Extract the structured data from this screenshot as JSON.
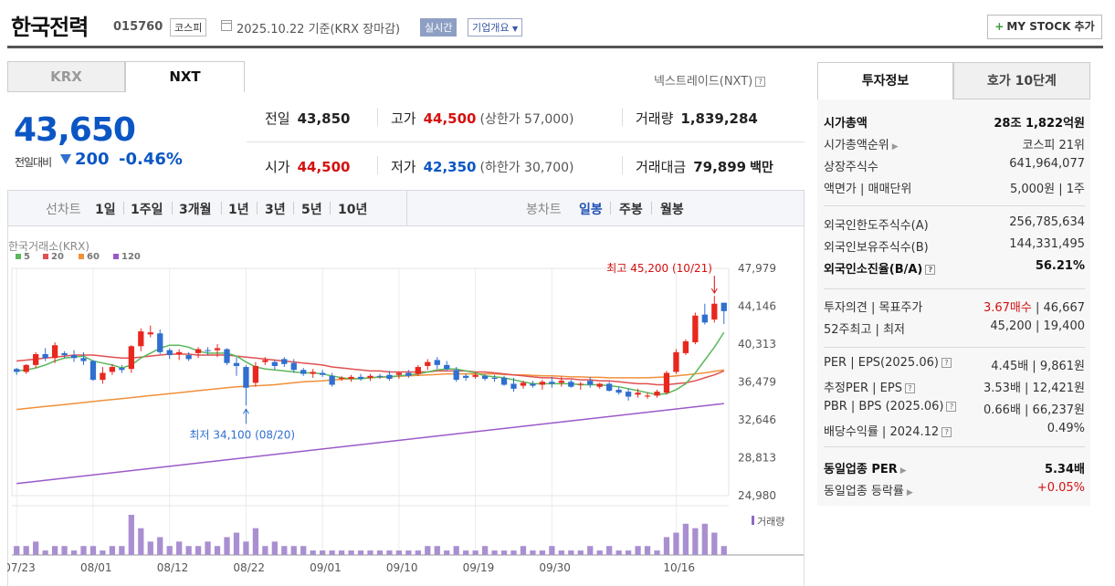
{
  "header": {
    "title": "한국전력",
    "code": "015760",
    "market": "코스피",
    "date": "2025.10.22 기준(KRX 장마감)",
    "realtime": "실시간",
    "company_info": "기업개요",
    "mystock": "MY STOCK 추가"
  },
  "exchange_tabs": [
    "KRX",
    "NXT"
  ],
  "nxt_link": "넥스트레이드(NXT)",
  "price": {
    "current": "43,650",
    "change_label": "전일대비",
    "change": "200",
    "change_pct": "-0.46%"
  },
  "summary": {
    "prev_close_label": "전일",
    "prev_close": "43,850",
    "high_label": "고가",
    "high": "44,500",
    "upper_limit": "(상한가 57,000)",
    "volume_label": "거래량",
    "volume": "1,839,284",
    "open_label": "시가",
    "open": "44,500",
    "low_label": "저가",
    "low": "42,350",
    "lower_limit": "(하한가 30,700)",
    "value_label": "거래대금",
    "value": "79,899",
    "value_unit": "백만"
  },
  "period_bar": {
    "line_label": "선차트",
    "periods": [
      "1일",
      "1주일",
      "3개월",
      "1년",
      "3년",
      "5년",
      "10년"
    ],
    "candle_label": "봉차트",
    "candles": [
      "일봉",
      "주봉",
      "월봉"
    ],
    "selected_candle": "일봉"
  },
  "chart": {
    "source": "한국거래소(KRX)",
    "ma_legend": [
      {
        "label": "5",
        "color": "#5cb85c"
      },
      {
        "label": "20",
        "color": "#e05050"
      },
      {
        "label": "60",
        "color": "#f0903a"
      },
      {
        "label": "120",
        "color": "#9b59c9"
      }
    ],
    "y_ticks": [
      "47,979",
      "44,146",
      "40,313",
      "36,479",
      "32,646",
      "28,813",
      "24,980"
    ],
    "x_ticks": [
      "07/23",
      "08/01",
      "08/12",
      "08/22",
      "09/01",
      "09/10",
      "09/19",
      "09/30",
      "10/16"
    ],
    "high_note": "최고 45,200 (10/21)",
    "low_note": "최저 34,100 (08/20)",
    "volume_label": "거래량"
  },
  "chart_data": {
    "type": "candlestick",
    "ylim": [
      24980,
      47979
    ],
    "candles": [
      [
        37800,
        37900,
        37200,
        37500
      ],
      [
        37500,
        38300,
        37300,
        38200
      ],
      [
        38200,
        39500,
        37900,
        39300
      ],
      [
        39300,
        39900,
        38600,
        38900
      ],
      [
        38900,
        40500,
        38400,
        40200
      ],
      [
        39400,
        39600,
        38900,
        39200
      ],
      [
        39200,
        39700,
        38500,
        38900
      ],
      [
        38900,
        39500,
        38200,
        38600
      ],
      [
        38600,
        38700,
        36600,
        36700
      ],
      [
        36700,
        38000,
        36300,
        37400
      ],
      [
        37500,
        38300,
        37200,
        38000
      ],
      [
        37900,
        38200,
        37400,
        37700
      ],
      [
        37800,
        40200,
        37400,
        40100
      ],
      [
        40100,
        41900,
        39600,
        41600
      ],
      [
        41300,
        42200,
        41000,
        41500
      ],
      [
        41400,
        41800,
        39300,
        39500
      ],
      [
        39700,
        39900,
        38800,
        39200
      ],
      [
        39300,
        39800,
        38700,
        39500
      ],
      [
        39200,
        39500,
        38600,
        38800
      ],
      [
        39400,
        40000,
        38900,
        39800
      ],
      [
        39700,
        40000,
        39200,
        39600
      ],
      [
        39700,
        40300,
        39000,
        39900
      ],
      [
        39800,
        39900,
        38200,
        38400
      ],
      [
        38400,
        39000,
        37100,
        38100
      ],
      [
        38000,
        38200,
        34100,
        35900
      ],
      [
        36400,
        38500,
        36000,
        38100
      ],
      [
        38500,
        39000,
        38200,
        38700
      ],
      [
        38500,
        38700,
        37700,
        38100
      ],
      [
        38800,
        39000,
        38000,
        38300
      ],
      [
        38400,
        38800,
        37400,
        37700
      ],
      [
        37700,
        37900,
        37100,
        37300
      ],
      [
        37300,
        37800,
        36900,
        37500
      ],
      [
        37400,
        37700,
        37000,
        37200
      ],
      [
        37100,
        37400,
        36000,
        36200
      ],
      [
        36800,
        37100,
        36600,
        36900
      ],
      [
        36800,
        37200,
        36500,
        37000
      ],
      [
        37000,
        37300,
        36600,
        36800
      ],
      [
        36900,
        37300,
        36600,
        37100
      ],
      [
        37100,
        37300,
        36800,
        37000
      ],
      [
        37200,
        37600,
        36600,
        36800
      ],
      [
        37200,
        37500,
        36800,
        37400
      ],
      [
        37400,
        37700,
        36900,
        37100
      ],
      [
        37300,
        38200,
        37100,
        38000
      ],
      [
        38100,
        38800,
        37700,
        38500
      ],
      [
        38700,
        39000,
        37800,
        38200
      ],
      [
        38200,
        38600,
        37600,
        37800
      ],
      [
        37700,
        38000,
        36500,
        36700
      ],
      [
        37100,
        37300,
        36600,
        36900
      ],
      [
        37000,
        37400,
        36800,
        37200
      ],
      [
        37100,
        37300,
        36600,
        36800
      ],
      [
        36900,
        37200,
        36500,
        36800
      ],
      [
        36900,
        37100,
        36100,
        36200
      ],
      [
        36300,
        36900,
        35500,
        35800
      ],
      [
        36100,
        36600,
        35800,
        36400
      ],
      [
        36300,
        36600,
        35900,
        36100
      ],
      [
        36200,
        36700,
        35700,
        36500
      ],
      [
        36500,
        37000,
        35900,
        36300
      ],
      [
        36400,
        37000,
        36000,
        36600
      ],
      [
        36500,
        36700,
        35900,
        36000
      ],
      [
        36200,
        36500,
        35700,
        36300
      ],
      [
        36600,
        37000,
        35900,
        36200
      ],
      [
        36000,
        36400,
        35800,
        36300
      ],
      [
        36300,
        36500,
        35500,
        35600
      ],
      [
        35700,
        36000,
        35200,
        35400
      ],
      [
        35500,
        35800,
        34600,
        35000
      ],
      [
        35200,
        35800,
        34900,
        35400
      ],
      [
        35000,
        35400,
        34800,
        35100
      ],
      [
        35100,
        35700,
        34900,
        35500
      ],
      [
        35400,
        37600,
        35200,
        37400
      ],
      [
        37500,
        39800,
        37300,
        39500
      ],
      [
        39400,
        40800,
        39200,
        40600
      ],
      [
        40500,
        43500,
        40300,
        43200
      ],
      [
        43300,
        44400,
        42300,
        42500
      ],
      [
        42800,
        45200,
        42500,
        44400
      ],
      [
        44500,
        44500,
        42350,
        43650
      ]
    ],
    "ma5": [
      37600,
      37700,
      37900,
      38200,
      38600,
      38900,
      39000,
      39100,
      38600,
      38400,
      38200,
      37900,
      38200,
      38900,
      39400,
      39900,
      40200,
      40200,
      40000,
      39600,
      39400,
      39400,
      39400,
      39100,
      38500,
      38000,
      37800,
      37700,
      37600,
      37500,
      37400,
      37400,
      37300,
      37100,
      36900,
      36800,
      36800,
      36900,
      37000,
      37000,
      37100,
      37200,
      37300,
      37500,
      37700,
      37800,
      37800,
      37600,
      37400,
      37100,
      37000,
      36900,
      36700,
      36500,
      36300,
      36300,
      36300,
      36300,
      36300,
      36200,
      36200,
      36200,
      36100,
      36000,
      35800,
      35600,
      35400,
      35200,
      35300,
      35700,
      36300,
      37400,
      38700,
      40000,
      41500
    ],
    "ma20": [
      38600,
      38700,
      38800,
      38900,
      39000,
      39100,
      39200,
      39200,
      39200,
      39100,
      39000,
      38900,
      38900,
      39000,
      39100,
      39200,
      39300,
      39300,
      39300,
      39200,
      39200,
      39200,
      39200,
      39100,
      39000,
      38900,
      38800,
      38700,
      38600,
      38500,
      38400,
      38300,
      38200,
      38000,
      37900,
      37800,
      37700,
      37600,
      37600,
      37500,
      37500,
      37500,
      37500,
      37500,
      37600,
      37600,
      37600,
      37600,
      37500,
      37500,
      37400,
      37300,
      37200,
      37100,
      37000,
      36900,
      36900,
      36800,
      36800,
      36700,
      36700,
      36600,
      36600,
      36500,
      36400,
      36300,
      36300,
      36200,
      36200,
      36300,
      36400,
      36600,
      36900,
      37200,
      37600
    ],
    "ma60": [
      33700,
      33800,
      33900,
      34000,
      34100,
      34200,
      34300,
      34400,
      34500,
      34600,
      34700,
      34800,
      34900,
      35000,
      35100,
      35200,
      35300,
      35400,
      35500,
      35600,
      35700,
      35800,
      35900,
      36000,
      36050,
      36100,
      36150,
      36200,
      36300,
      36400,
      36500,
      36550,
      36600,
      36700,
      36750,
      36800,
      36850,
      36900,
      36950,
      37000,
      37050,
      37100,
      37150,
      37200,
      37250,
      37300,
      37300,
      37300,
      37300,
      37300,
      37300,
      37250,
      37200,
      37200,
      37150,
      37100,
      37100,
      37050,
      37000,
      37000,
      36950,
      36950,
      36900,
      36900,
      36900,
      36900,
      36900,
      36950,
      37000,
      37100,
      37200,
      37300,
      37400,
      37550,
      37700
    ],
    "ma120_range": [
      26200,
      34300
    ],
    "volumes": [
      2,
      2,
      3,
      1,
      2,
      2,
      1,
      2,
      2,
      1,
      2,
      2,
      9,
      6,
      3,
      4,
      2,
      3,
      2,
      2,
      3,
      2,
      4,
      5,
      3,
      6,
      2,
      3,
      2,
      2,
      2,
      1,
      1,
      1,
      1,
      1,
      1,
      1,
      1,
      1,
      1,
      1,
      1,
      2,
      2,
      1,
      2,
      1,
      1,
      2,
      1,
      1,
      1,
      2,
      1,
      1,
      2,
      1,
      1,
      1,
      2,
      1,
      2,
      1,
      1,
      2,
      2,
      1,
      4,
      5,
      7,
      6,
      7,
      5,
      2
    ]
  },
  "invest": {
    "tabs": [
      "투자정보",
      "호가 10단계"
    ],
    "rows1": [
      {
        "label": "시가총액",
        "value": "28조 1,822억원",
        "bold": true
      },
      {
        "label": "시가총액순위",
        "value": "코스피 21위"
      },
      {
        "label": "상장주식수",
        "value": "641,964,077"
      },
      {
        "label": "액면가 | 매매단위",
        "value": "5,000원 | 1주"
      }
    ],
    "rows2": [
      {
        "label": "외국인한도주식수(A)",
        "value": "256,785,634"
      },
      {
        "label": "외국인보유주식수(B)",
        "value": "144,331,495"
      },
      {
        "label": "외국인소진율(B/A)",
        "value": "56.21%",
        "bold": true
      }
    ],
    "rows3": [
      {
        "label": "투자의견 | 목표주가",
        "value_red": "3.67매수",
        "value": " | 46,667"
      },
      {
        "label": "52주최고 | 최저",
        "value": "45,200 | 19,400"
      }
    ],
    "rows4": [
      {
        "label": "PER | EPS(2025.06)",
        "value": "4.45배 | 9,861원"
      },
      {
        "label": "추정PER | EPS",
        "value": "3.53배 | 12,421원"
      },
      {
        "label": "PBR | BPS (2025.06)",
        "value": "0.66배 | 66,237원"
      },
      {
        "label": "배당수익률 | 2024.12",
        "value": "0.49%"
      }
    ],
    "rows5": [
      {
        "label": "동일업종 PER",
        "value": "5.34배",
        "bold": true
      },
      {
        "label": "동일업종 등락률",
        "value": "+0.05%",
        "red": true
      }
    ]
  }
}
